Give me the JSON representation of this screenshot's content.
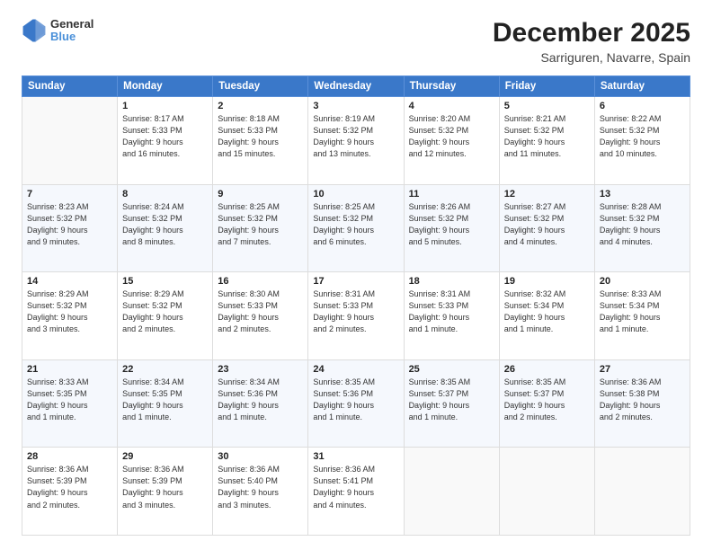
{
  "logo": {
    "line1": "General",
    "line2": "Blue"
  },
  "title": "December 2025",
  "subtitle": "Sarriguren, Navarre, Spain",
  "days_header": [
    "Sunday",
    "Monday",
    "Tuesday",
    "Wednesday",
    "Thursday",
    "Friday",
    "Saturday"
  ],
  "weeks": [
    [
      {
        "day": "",
        "info": ""
      },
      {
        "day": "1",
        "info": "Sunrise: 8:17 AM\nSunset: 5:33 PM\nDaylight: 9 hours\nand 16 minutes."
      },
      {
        "day": "2",
        "info": "Sunrise: 8:18 AM\nSunset: 5:33 PM\nDaylight: 9 hours\nand 15 minutes."
      },
      {
        "day": "3",
        "info": "Sunrise: 8:19 AM\nSunset: 5:32 PM\nDaylight: 9 hours\nand 13 minutes."
      },
      {
        "day": "4",
        "info": "Sunrise: 8:20 AM\nSunset: 5:32 PM\nDaylight: 9 hours\nand 12 minutes."
      },
      {
        "day": "5",
        "info": "Sunrise: 8:21 AM\nSunset: 5:32 PM\nDaylight: 9 hours\nand 11 minutes."
      },
      {
        "day": "6",
        "info": "Sunrise: 8:22 AM\nSunset: 5:32 PM\nDaylight: 9 hours\nand 10 minutes."
      }
    ],
    [
      {
        "day": "7",
        "info": "Sunrise: 8:23 AM\nSunset: 5:32 PM\nDaylight: 9 hours\nand 9 minutes."
      },
      {
        "day": "8",
        "info": "Sunrise: 8:24 AM\nSunset: 5:32 PM\nDaylight: 9 hours\nand 8 minutes."
      },
      {
        "day": "9",
        "info": "Sunrise: 8:25 AM\nSunset: 5:32 PM\nDaylight: 9 hours\nand 7 minutes."
      },
      {
        "day": "10",
        "info": "Sunrise: 8:25 AM\nSunset: 5:32 PM\nDaylight: 9 hours\nand 6 minutes."
      },
      {
        "day": "11",
        "info": "Sunrise: 8:26 AM\nSunset: 5:32 PM\nDaylight: 9 hours\nand 5 minutes."
      },
      {
        "day": "12",
        "info": "Sunrise: 8:27 AM\nSunset: 5:32 PM\nDaylight: 9 hours\nand 4 minutes."
      },
      {
        "day": "13",
        "info": "Sunrise: 8:28 AM\nSunset: 5:32 PM\nDaylight: 9 hours\nand 4 minutes."
      }
    ],
    [
      {
        "day": "14",
        "info": "Sunrise: 8:29 AM\nSunset: 5:32 PM\nDaylight: 9 hours\nand 3 minutes."
      },
      {
        "day": "15",
        "info": "Sunrise: 8:29 AM\nSunset: 5:32 PM\nDaylight: 9 hours\nand 2 minutes."
      },
      {
        "day": "16",
        "info": "Sunrise: 8:30 AM\nSunset: 5:33 PM\nDaylight: 9 hours\nand 2 minutes."
      },
      {
        "day": "17",
        "info": "Sunrise: 8:31 AM\nSunset: 5:33 PM\nDaylight: 9 hours\nand 2 minutes."
      },
      {
        "day": "18",
        "info": "Sunrise: 8:31 AM\nSunset: 5:33 PM\nDaylight: 9 hours\nand 1 minute."
      },
      {
        "day": "19",
        "info": "Sunrise: 8:32 AM\nSunset: 5:34 PM\nDaylight: 9 hours\nand 1 minute."
      },
      {
        "day": "20",
        "info": "Sunrise: 8:33 AM\nSunset: 5:34 PM\nDaylight: 9 hours\nand 1 minute."
      }
    ],
    [
      {
        "day": "21",
        "info": "Sunrise: 8:33 AM\nSunset: 5:35 PM\nDaylight: 9 hours\nand 1 minute."
      },
      {
        "day": "22",
        "info": "Sunrise: 8:34 AM\nSunset: 5:35 PM\nDaylight: 9 hours\nand 1 minute."
      },
      {
        "day": "23",
        "info": "Sunrise: 8:34 AM\nSunset: 5:36 PM\nDaylight: 9 hours\nand 1 minute."
      },
      {
        "day": "24",
        "info": "Sunrise: 8:35 AM\nSunset: 5:36 PM\nDaylight: 9 hours\nand 1 minute."
      },
      {
        "day": "25",
        "info": "Sunrise: 8:35 AM\nSunset: 5:37 PM\nDaylight: 9 hours\nand 1 minute."
      },
      {
        "day": "26",
        "info": "Sunrise: 8:35 AM\nSunset: 5:37 PM\nDaylight: 9 hours\nand 2 minutes."
      },
      {
        "day": "27",
        "info": "Sunrise: 8:36 AM\nSunset: 5:38 PM\nDaylight: 9 hours\nand 2 minutes."
      }
    ],
    [
      {
        "day": "28",
        "info": "Sunrise: 8:36 AM\nSunset: 5:39 PM\nDaylight: 9 hours\nand 2 minutes."
      },
      {
        "day": "29",
        "info": "Sunrise: 8:36 AM\nSunset: 5:39 PM\nDaylight: 9 hours\nand 3 minutes."
      },
      {
        "day": "30",
        "info": "Sunrise: 8:36 AM\nSunset: 5:40 PM\nDaylight: 9 hours\nand 3 minutes."
      },
      {
        "day": "31",
        "info": "Sunrise: 8:36 AM\nSunset: 5:41 PM\nDaylight: 9 hours\nand 4 minutes."
      },
      {
        "day": "",
        "info": ""
      },
      {
        "day": "",
        "info": ""
      },
      {
        "day": "",
        "info": ""
      }
    ]
  ]
}
